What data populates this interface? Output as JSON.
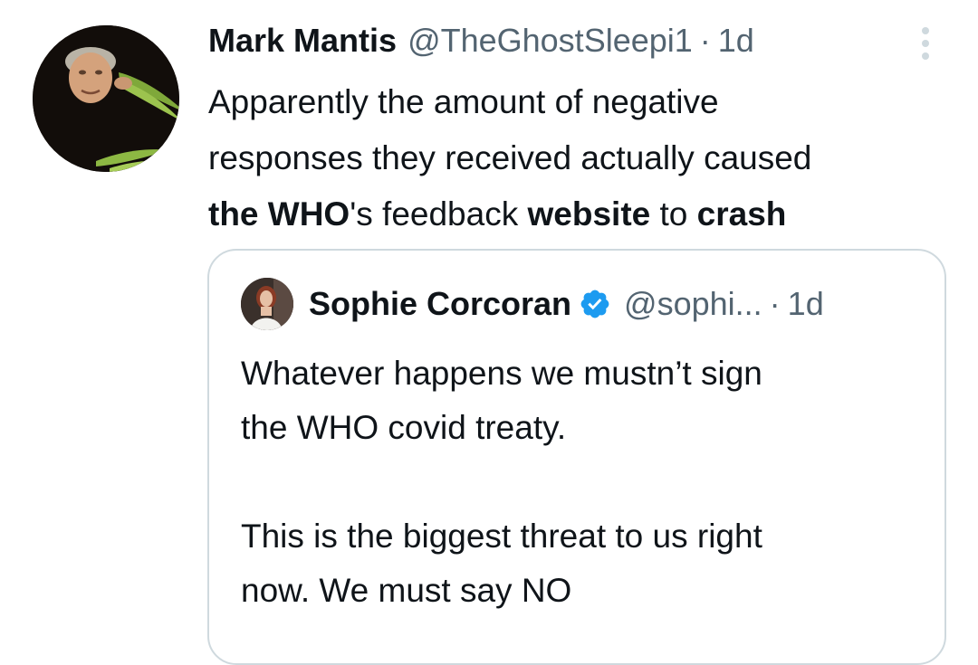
{
  "tweet": {
    "author_name": "Mark Mantis",
    "author_handle": "@TheGhostSleepi1",
    "separator": "·",
    "time": "1d",
    "more_icon": "more-vertical-icon",
    "text_lines": [
      [
        {
          "text": "Apparently the amount of negative",
          "bold": false
        }
      ],
      [
        {
          "text": "responses they received actually caused",
          "bold": false
        }
      ],
      [
        {
          "text": "the WHO",
          "bold": true
        },
        {
          "text": "'s feedback ",
          "bold": false
        },
        {
          "text": "website",
          "bold": true
        },
        {
          "text": " to ",
          "bold": false
        },
        {
          "text": "crash",
          "bold": true
        }
      ]
    ]
  },
  "quote": {
    "author_name": "Sophie Corcoran",
    "verified_icon": "verified-badge-icon",
    "author_handle": "@sophi...",
    "separator": "·",
    "time": "1d",
    "paragraphs": [
      [
        "Whatever happens we mustn’t sign",
        "the WHO covid treaty."
      ],
      [
        "This is the biggest threat to us right",
        "now. We must say NO"
      ]
    ]
  },
  "colors": {
    "text_primary": "#0f1419",
    "text_secondary": "#536471",
    "border": "#cfd9de",
    "verified_blue": "#1d9bf0"
  }
}
